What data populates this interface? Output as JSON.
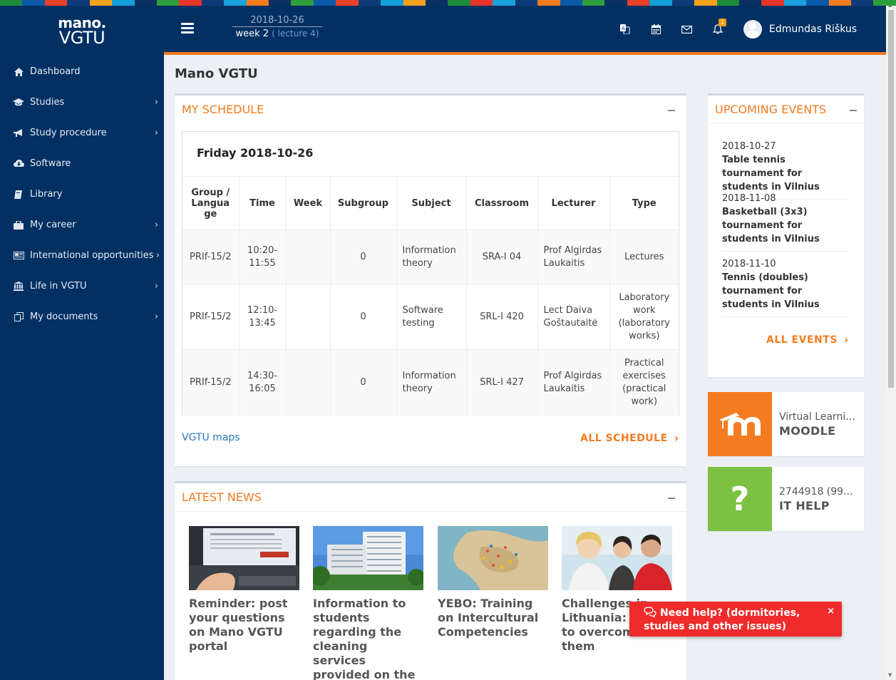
{
  "brand": {
    "line1": "mano.",
    "line2": "VGTU"
  },
  "header": {
    "date": "2018-10-26",
    "week": "week 2",
    "lecture": "( lecture 4)",
    "notification_count": "1",
    "user_name": "Edmundas Riškus"
  },
  "sidebar": {
    "items": [
      {
        "label": "Dashboard",
        "icon": "home-icon",
        "has_submenu": false
      },
      {
        "label": "Studies",
        "icon": "graduation-cap-icon",
        "has_submenu": true
      },
      {
        "label": "Study procedure",
        "icon": "bullhorn-icon",
        "has_submenu": true
      },
      {
        "label": "Software",
        "icon": "cloud-download-icon",
        "has_submenu": false
      },
      {
        "label": "Library",
        "icon": "book-icon",
        "has_submenu": false
      },
      {
        "label": "My career",
        "icon": "briefcase-icon",
        "has_submenu": true
      },
      {
        "label": "International opportunities",
        "icon": "newspaper-icon",
        "has_submenu": true
      },
      {
        "label": "Life in VGTU",
        "icon": "bank-icon",
        "has_submenu": true
      },
      {
        "label": "My documents",
        "icon": "copy-icon",
        "has_submenu": true
      }
    ]
  },
  "page": {
    "title": "Mano VGTU"
  },
  "schedule": {
    "title": "MY SCHEDULE",
    "day": "Friday 2018-10-26",
    "columns": [
      "Group / Langua ge",
      "Time",
      "Week",
      "Subgroup",
      "Subject",
      "Classroom",
      "Lecturer",
      "Type"
    ],
    "rows": [
      {
        "group": "PRIf-15/2",
        "time": "10:20-11:55",
        "week": "",
        "subgroup": "0",
        "subject": "Information theory",
        "classroom": "SRA-I 04",
        "lecturer": "Prof Algirdas Laukaitis",
        "type": "Lectures"
      },
      {
        "group": "PRIf-15/2",
        "time": "12:10-13:45",
        "week": "",
        "subgroup": "0",
        "subject": "Software testing",
        "classroom": "SRL-I 420",
        "lecturer": "Lect Daiva Goštautaitė",
        "type": "Laboratory work (laboratory works)"
      },
      {
        "group": "PRIf-15/2",
        "time": "14:30-16:05",
        "week": "",
        "subgroup": "0",
        "subject": "Information theory",
        "classroom": "SRL-I 427",
        "lecturer": "Prof Algirdas Laukaitis",
        "type": "Practical exercises (practical work)"
      }
    ],
    "maps_link": "VGTU maps",
    "all_link": "ALL SCHEDULE"
  },
  "events": {
    "title": "UPCOMING EVENTS",
    "items": [
      {
        "date": "2018-10-27",
        "title": "Table tennis tournament for students in Vilnius"
      },
      {
        "date": "2018-11-08",
        "title": "Basketball (3x3) tournament for students in Vilnius"
      },
      {
        "date": "2018-11-10",
        "title": "Tennis (doubles) tournament for students in Vilnius"
      }
    ],
    "all_link": "ALL EVENTS"
  },
  "tiles": {
    "moodle": {
      "sub": "Virtual Learning Environment",
      "main": "MOODLE",
      "color": "#f47b20"
    },
    "ithelp": {
      "sub": "2744918 (99...",
      "main": "IT HELP",
      "color": "#7cc142"
    }
  },
  "news": {
    "title": "LATEST NEWS",
    "items": [
      {
        "title": "Reminder: post your questions on Mano VGTU portal"
      },
      {
        "title": "Information to students regarding the cleaning services provided on the premises of VGTU"
      },
      {
        "title": "YEBO: Training on Intercultural Competencies"
      },
      {
        "title": "Challenges in Lithuania: How to overcome them"
      }
    ]
  },
  "help": {
    "text": "Need help? (dormitories, studies and other issues)",
    "close": "×"
  },
  "colors": {
    "navy": "#023063",
    "accent": "#f47b20",
    "help_red": "#ef2b2b"
  }
}
